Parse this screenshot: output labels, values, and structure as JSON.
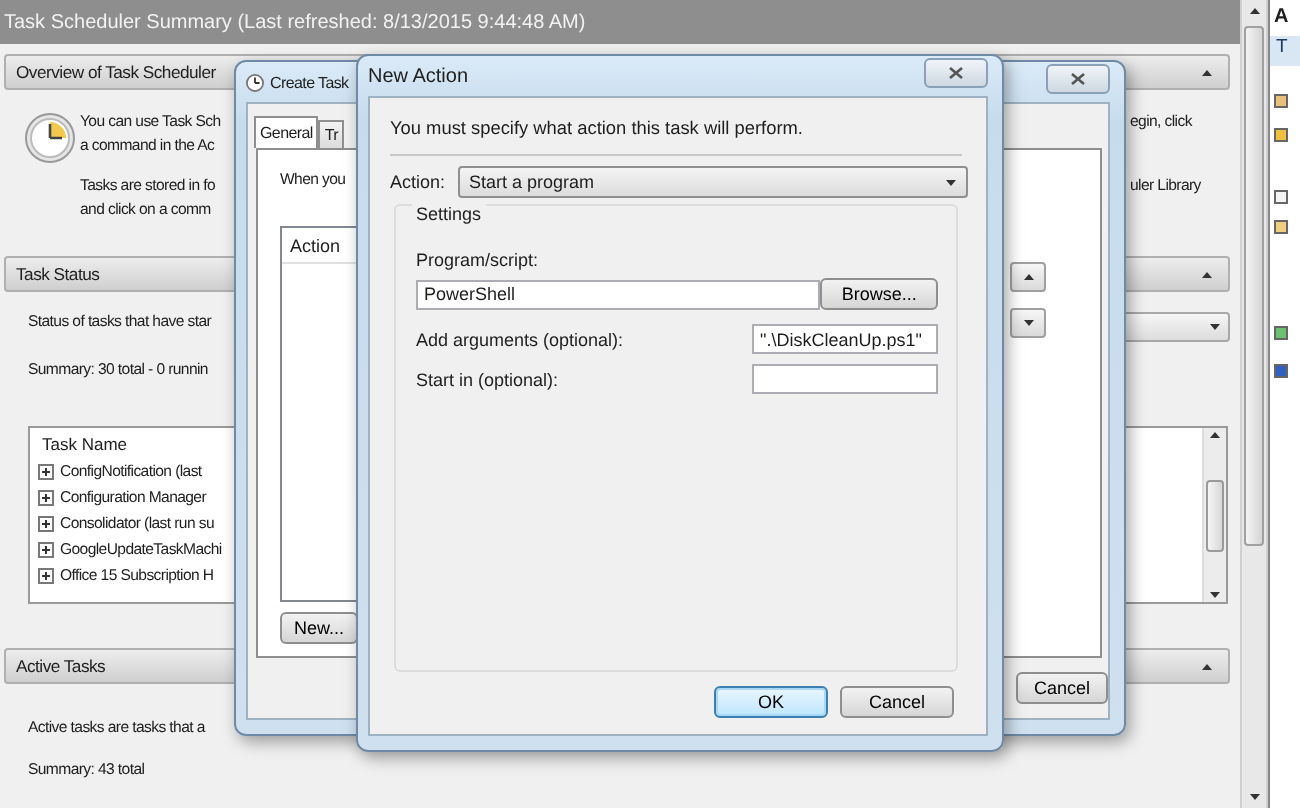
{
  "main": {
    "title": "Task Scheduler Summary (Last refreshed: 8/13/2015 9:44:48 AM)",
    "overview": {
      "title": "Overview of Task Scheduler",
      "lines_left": [
        "You can use Task Sch",
        "a command in the Ac",
        "Tasks are stored in fo",
        "and click on a comm"
      ],
      "lines_right": [
        "egin, click",
        "uler Library"
      ]
    },
    "task_status": {
      "title": "Task Status",
      "status_text": "Status of tasks that have star",
      "summary": "Summary: 30 total - 0 runnin",
      "list_header": "Task Name",
      "rows": [
        {
          "label": "ConfigNotification (last"
        },
        {
          "label": "Configuration Manager"
        },
        {
          "label": "Consolidator (last run su"
        },
        {
          "label": "GoogleUpdateTaskMachi"
        },
        {
          "label": "Office 15 Subscription H"
        }
      ]
    },
    "active_tasks": {
      "title": "Active Tasks",
      "description": "Active tasks are tasks that a",
      "summary": "Summary: 43 total"
    }
  },
  "actions_pane": {
    "title": "A",
    "items": [
      {
        "label": "T",
        "selected": true
      }
    ]
  },
  "create_task": {
    "title": "Create Task",
    "tabs": [
      {
        "label": "General",
        "selected": true
      },
      {
        "label": "Tr",
        "selected": false
      }
    ],
    "intro": "When you",
    "list_header": "Action",
    "new_button": "New...",
    "cancel_button": "Cancel"
  },
  "new_action": {
    "title": "New Action",
    "instruction": "You must specify what action this task will perform.",
    "action_label": "Action:",
    "action_value": "Start a program",
    "group_title": "Settings",
    "program_label": "Program/script:",
    "program_value": "PowerShell",
    "browse_button": "Browse...",
    "arguments_label": "Add arguments (optional):",
    "arguments_value": "\".\\DiskCleanUp.ps1\"",
    "start_label": "Start in (optional):",
    "buttons": [
      {
        "label": "OK",
        "default": true
      },
      {
        "label": "Cancel",
        "default": false
      }
    ]
  }
}
